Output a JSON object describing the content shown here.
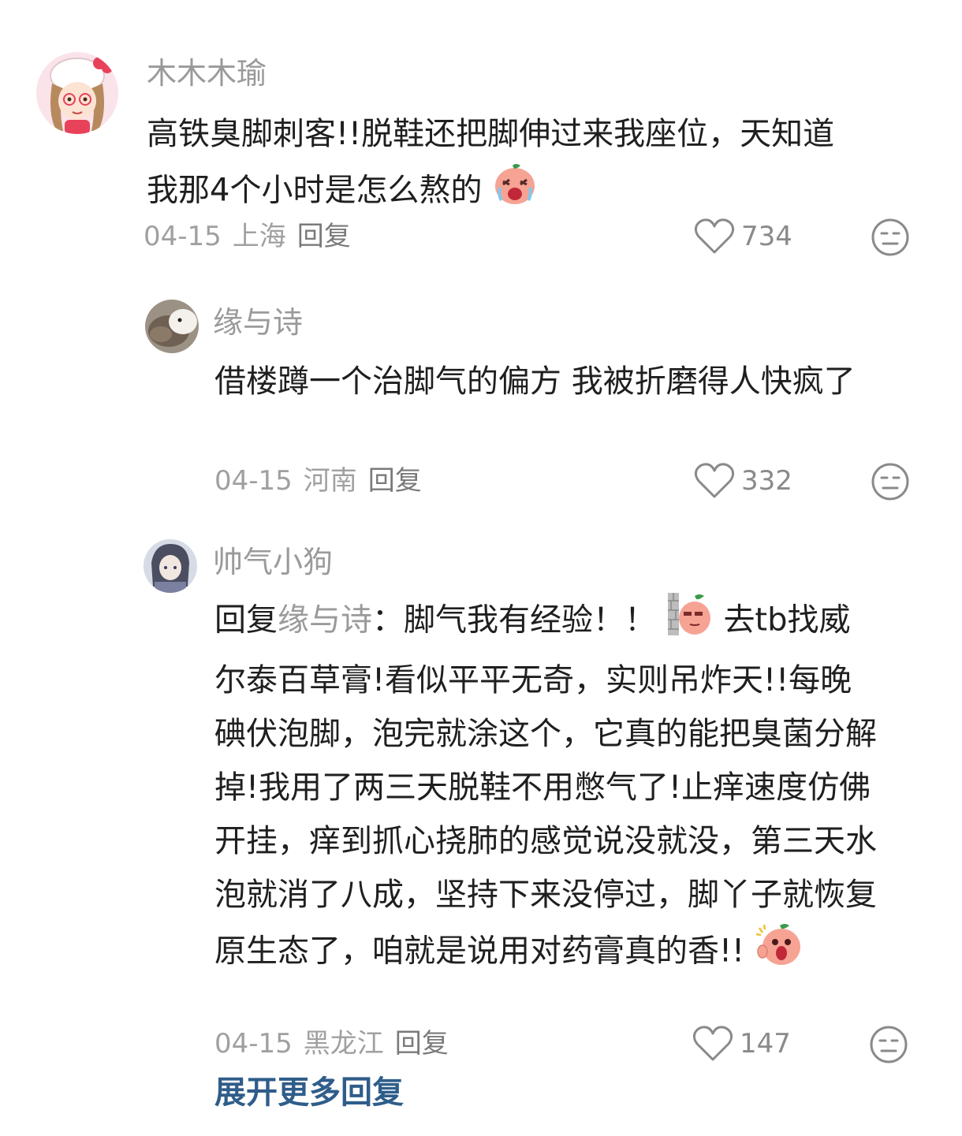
{
  "comments": [
    {
      "user": "木木木瑜",
      "text_part1": "高铁臭脚刺客!!脱鞋还把脚伸过来我座位，天知道我那4个小时是怎么熬的",
      "date": "04-15",
      "location": "上海",
      "reply_label": "回复",
      "likes": "734",
      "emoji": "crying-peach-emoji",
      "avatar": "hello-kitty-girl-avatar"
    },
    {
      "user": "缘与诗",
      "text_part1": "借楼蹲一个治脚气的偏方 我被折磨得人快疯了",
      "date": "04-15",
      "location": "河南",
      "reply_label": "回复",
      "likes": "332",
      "avatar": "hamster-avatar"
    },
    {
      "user": "帅气小狗",
      "reply_prefix": "回复",
      "reply_to": "缘与诗",
      "text_part1": "：脚气我有经验！！",
      "text_part2": "去tb找威尔泰百草膏!看似平平无奇，实则吊炸天!!每晚碘伏泡脚，泡完就涂这个，它真的能把臭菌分解掉!我用了两三天脱鞋不用憋气了!止痒速度仿佛开挂，痒到抓心挠肺的感觉说没就没，第三天水泡就消了八成，坚持下来没停过，脚丫子就恢复原生态了，咱就是说用对药膏真的香!!",
      "date": "04-15",
      "location": "黑龙江",
      "reply_label": "回复",
      "likes": "147",
      "emoji_mid": "peeking-peach-wall-emoji",
      "emoji_end": "shocked-peach-emoji",
      "avatar": "anime-character-avatar"
    }
  ],
  "expand_more": "展开更多回复",
  "icons": {
    "like": "heart-outline-icon",
    "dislike": "neutral-face-icon"
  },
  "colors": {
    "username": "#9a9a9a",
    "body": "#1f1f1f",
    "meta": "#a0a0a0",
    "expand": "#2f5d8a",
    "peach": "#f39a8c"
  }
}
